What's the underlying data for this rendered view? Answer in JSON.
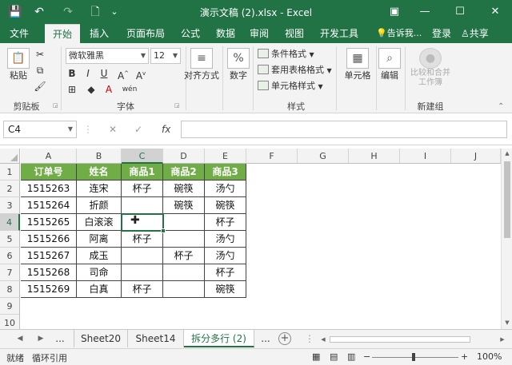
{
  "titlebar": {
    "title": "演示文稿 (2).xlsx - Excel",
    "save_icon": "💾",
    "undo_icon": "↶",
    "redo_icon": "↷",
    "new_icon": "🗋",
    "qa_icon": "⌄",
    "ribbon_display_icon": "▣",
    "minimize_icon": "—",
    "maximize_icon": "☐",
    "close_icon": "✕"
  },
  "tabs": [
    "文件",
    "开始",
    "插入",
    "页面布局",
    "公式",
    "数据",
    "审阅",
    "视图",
    "开发工具"
  ],
  "tellme": "告诉我...",
  "login": "登录",
  "share": "共享",
  "ribbon": {
    "paste": "粘贴",
    "clipboard": "剪贴板",
    "font_name": "微软雅黑",
    "font_size": "12",
    "font_group": "字体",
    "align": "对齐方式",
    "number": "数字",
    "number_icon": "%",
    "cond_format": "条件格式",
    "table_format": "套用表格格式",
    "cell_styles": "单元格样式",
    "styles_group": "样式",
    "cells": "单元格",
    "edit": "编辑",
    "compare": "比较和合并\n工作簿",
    "new_group": "新建组",
    "bold": "B",
    "italic": "I",
    "underline": "U",
    "wen": "wén",
    "font_color": "A"
  },
  "formula_bar": {
    "name_box": "C4",
    "cancel": "✕",
    "enter": "✓",
    "fx": "fx",
    "value": ""
  },
  "grid": {
    "columns": [
      "A",
      "B",
      "C",
      "D",
      "E",
      "F",
      "G",
      "H",
      "I",
      "J"
    ],
    "rows": [
      "1",
      "2",
      "3",
      "4",
      "5",
      "6",
      "7",
      "8",
      "9",
      "10"
    ],
    "headers": [
      "订单号",
      "姓名",
      "商品1",
      "商品2",
      "商品3"
    ],
    "data": [
      [
        "1515263",
        "连宋",
        "杯子",
        "碗筷",
        "汤勺"
      ],
      [
        "1515264",
        "折颜",
        "",
        "碗筷",
        "碗筷"
      ],
      [
        "1515265",
        "白滚滚",
        "",
        "",
        "杯子"
      ],
      [
        "1515266",
        "阿离",
        "杯子",
        "",
        "汤勺"
      ],
      [
        "1515267",
        "成玉",
        "",
        "杯子",
        "汤勺"
      ],
      [
        "1515268",
        "司命",
        "",
        "",
        "杯子"
      ],
      [
        "1515269",
        "白真",
        "杯子",
        "",
        "碗筷"
      ]
    ],
    "header_color": "#70ad47",
    "selected_cell": "C4"
  },
  "sheets": {
    "ellipsis_left": "...",
    "tabs": [
      "Sheet20",
      "Sheet14",
      "拆分多行 (2)"
    ],
    "active": "拆分多行 (2)",
    "ellipsis_right": "..."
  },
  "status": {
    "ready": "就绪",
    "circular": "循环引用",
    "zoom": "100%",
    "minus": "−",
    "plus": "+"
  },
  "colors": {
    "accent": "#217346",
    "table_header": "#70ad47"
  }
}
